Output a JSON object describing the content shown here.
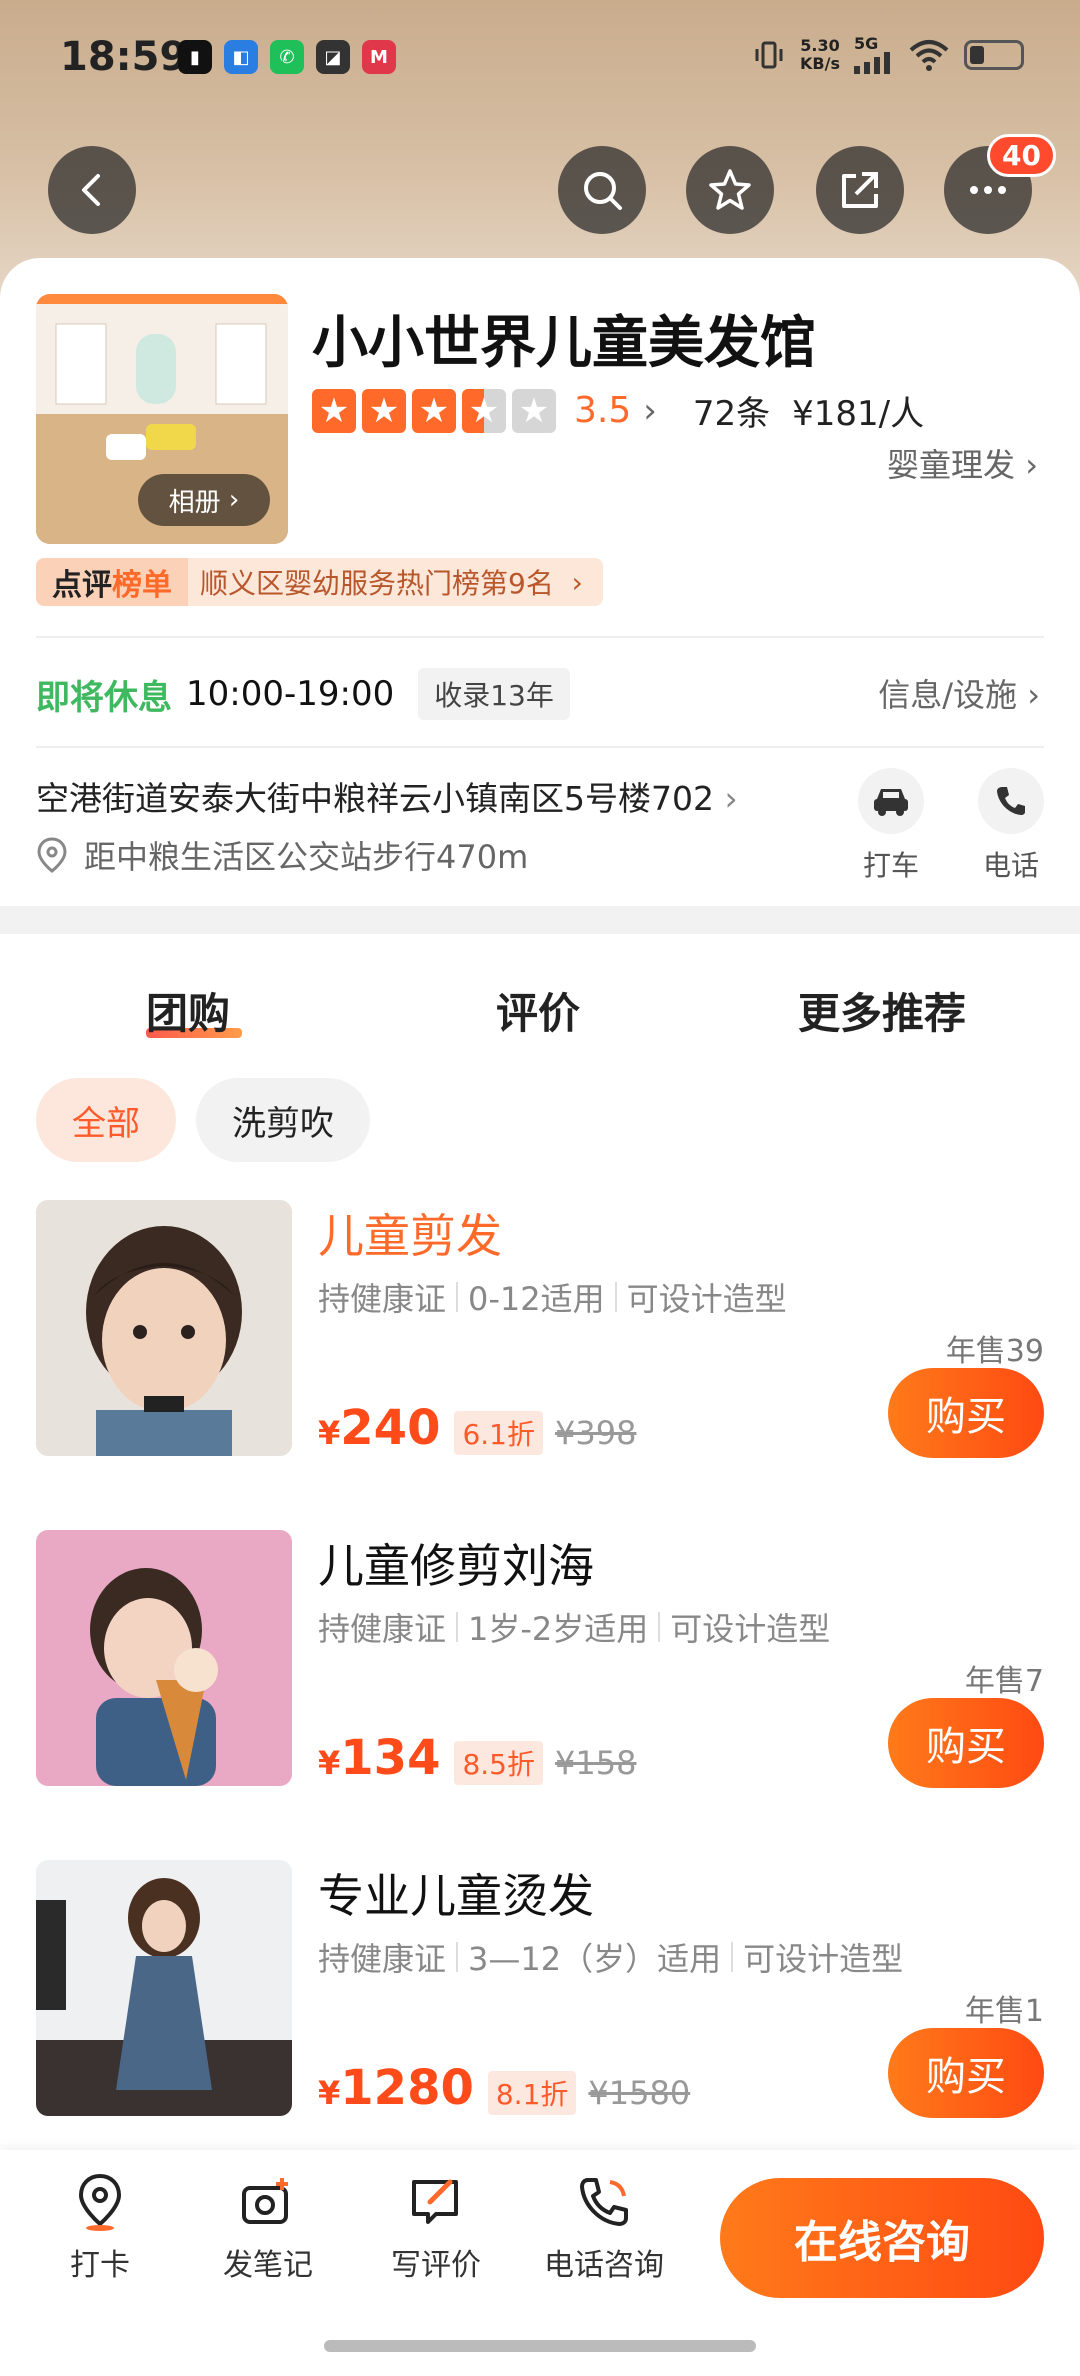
{
  "status_bar": {
    "time": "18:59",
    "net_speed_top": "5.30",
    "net_speed_bottom": "KB/s",
    "network": "5G"
  },
  "nav": {
    "notification_count": "40"
  },
  "shop": {
    "name": "小小世界儿童美发馆",
    "rating": "3.5",
    "stars_filled": 3.5,
    "review_count": "72条",
    "avg_price": "¥181/人",
    "category": "婴童理发",
    "album_label": "相册",
    "rank_badge_a": "点评",
    "rank_badge_b": "榜单",
    "rank_text": "顺义区婴幼服务热门榜第9名",
    "hours_status": "即将休息",
    "hours": "10:00-19:00",
    "since": "收录13年",
    "info_link": "信息/设施",
    "address": "空港街道安泰大街中粮祥云小镇南区5号楼702",
    "distance": "距中粮生活区公交站步行470m",
    "taxi_label": "打车",
    "phone_label": "电话"
  },
  "tabs": [
    "团购",
    "评价",
    "更多推荐"
  ],
  "filters": [
    "全部",
    "洗剪吹"
  ],
  "deals": [
    {
      "title": "儿童剪发",
      "tags": [
        "持健康证",
        "0-12适用",
        "可设计造型"
      ],
      "sales": "年售39",
      "yen": "¥",
      "price": "240",
      "discount": "6.1折",
      "original": "¥398",
      "buy": "购买"
    },
    {
      "title": "儿童修剪刘海",
      "tags": [
        "持健康证",
        "1岁-2岁适用",
        "可设计造型"
      ],
      "sales": "年售7",
      "yen": "¥",
      "price": "134",
      "discount": "8.5折",
      "original": "¥158",
      "buy": "购买"
    },
    {
      "title": "专业儿童烫发",
      "tags": [
        "持健康证",
        "3—12（岁）适用",
        "可设计造型"
      ],
      "sales": "年售1",
      "yen": "¥",
      "price": "1280",
      "discount": "8.1折",
      "original": "¥1580",
      "buy": "购买"
    }
  ],
  "bottom_bar": {
    "checkin": "打卡",
    "note": "发笔记",
    "review": "写评价",
    "phone_consult": "电话咨询",
    "online_consult": "在线咨询"
  },
  "colors": {
    "accent": "#ff5a1f",
    "open_green": "#3fb960"
  }
}
